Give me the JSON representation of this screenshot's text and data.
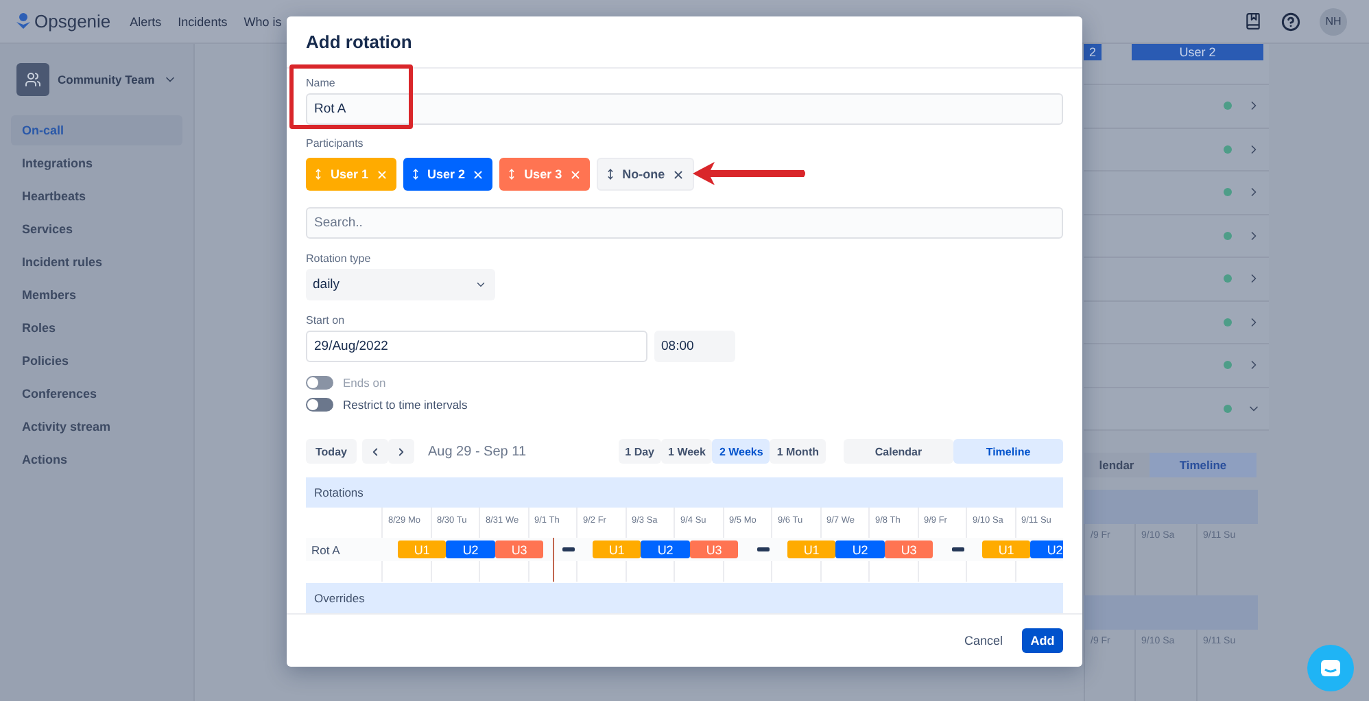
{
  "topbar": {
    "logo": "Opsgenie",
    "nav": [
      "Alerts",
      "Incidents",
      "Who is"
    ],
    "avatar": "NH"
  },
  "sidebar": {
    "team": "Community Team",
    "items": [
      {
        "label": "On-call",
        "selected": true
      },
      {
        "label": "Integrations",
        "selected": false
      },
      {
        "label": "Heartbeats",
        "selected": false
      },
      {
        "label": "Services",
        "selected": false
      },
      {
        "label": "Incident rules",
        "selected": false
      },
      {
        "label": "Members",
        "selected": false
      },
      {
        "label": "Roles",
        "selected": false
      },
      {
        "label": "Policies",
        "selected": false
      },
      {
        "label": "Conferences",
        "selected": false
      },
      {
        "label": "Activity stream",
        "selected": false
      },
      {
        "label": "Actions",
        "selected": false
      }
    ]
  },
  "background": {
    "badges": [
      "2",
      "User 2"
    ],
    "rows": [
      {
        "expanded": false
      },
      {
        "expanded": false
      },
      {
        "expanded": false
      },
      {
        "expanded": false
      },
      {
        "expanded": false
      },
      {
        "expanded": false
      },
      {
        "expanded": false
      },
      {
        "expanded": true
      }
    ],
    "view_tabs": [
      {
        "label": "lendar",
        "selected": false
      },
      {
        "label": "Timeline",
        "selected": true
      }
    ],
    "rotations_days": [
      "/9 Fr",
      "9/10 Sa",
      "9/11 Su"
    ],
    "overrides_days": [
      "/9 Fr",
      "9/10 Sa",
      "9/11 Su"
    ]
  },
  "dialog": {
    "title": "Add rotation",
    "name": {
      "label": "Name",
      "value": "Rot A"
    },
    "participants": {
      "label": "Participants",
      "items": [
        {
          "name": "User 1",
          "kind": "user",
          "color": "#ffab00"
        },
        {
          "name": "User 2",
          "kind": "user",
          "color": "#0065ff"
        },
        {
          "name": "User 3",
          "kind": "user",
          "color": "#ff7452"
        },
        {
          "name": "No-one",
          "kind": "none",
          "color": "#f4f5f7"
        }
      ]
    },
    "search": {
      "placeholder": "Search.."
    },
    "rotation_type": {
      "label": "Rotation type",
      "value": "daily"
    },
    "start_on": {
      "label": "Start on",
      "date": "29/Aug/2022",
      "time": "08:00"
    },
    "toggles": [
      {
        "label": "Ends on",
        "on": false,
        "disabled": true
      },
      {
        "label": "Restrict to time intervals",
        "on": false,
        "disabled": false
      }
    ],
    "toolbar": {
      "today": "Today",
      "range": "Aug 29 - Sep 11",
      "periods": [
        {
          "label": "1 Day",
          "selected": false
        },
        {
          "label": "1 Week",
          "selected": false
        },
        {
          "label": "2 Weeks",
          "selected": true
        },
        {
          "label": "1 Month",
          "selected": false
        }
      ],
      "views": [
        {
          "label": "Calendar",
          "selected": false
        },
        {
          "label": "Timeline",
          "selected": true
        }
      ]
    },
    "timeline": {
      "rotations_title": "Rotations",
      "days": [
        "8/29 Mo",
        "8/30 Tu",
        "8/31 We",
        "9/1 Th",
        "9/2 Fr",
        "9/3 Sa",
        "9/4 Su",
        "9/5 Mo",
        "9/6 Tu",
        "9/7 We",
        "9/8 Th",
        "9/9 Fr",
        "9/10 Sa",
        "9/11 Su"
      ],
      "now_marker": {
        "level": 0.252
      },
      "rows": [
        {
          "name": "Rot A",
          "segments": [
            {
              "label": "U1",
              "kind": "user",
              "color": "#ffab00"
            },
            {
              "label": "U2",
              "kind": "user",
              "color": "#0065ff"
            },
            {
              "label": "U3",
              "kind": "user",
              "color": "#ff7452"
            },
            {
              "kind": "none"
            },
            {
              "label": "U1",
              "kind": "user",
              "color": "#ffab00"
            },
            {
              "label": "U2",
              "kind": "user",
              "color": "#0065ff"
            },
            {
              "label": "U3",
              "kind": "user",
              "color": "#ff7452"
            },
            {
              "kind": "none"
            },
            {
              "label": "U1",
              "kind": "user",
              "color": "#ffab00"
            },
            {
              "label": "U2",
              "kind": "user",
              "color": "#0065ff"
            },
            {
              "label": "U3",
              "kind": "user",
              "color": "#ff7452"
            },
            {
              "kind": "none"
            },
            {
              "label": "U1",
              "kind": "user",
              "color": "#ffab00"
            },
            {
              "label": "U2",
              "kind": "user",
              "color": "#0065ff"
            }
          ]
        }
      ],
      "overrides_title": "Overrides"
    },
    "footer": {
      "cancel": "Cancel",
      "add": "Add"
    }
  }
}
